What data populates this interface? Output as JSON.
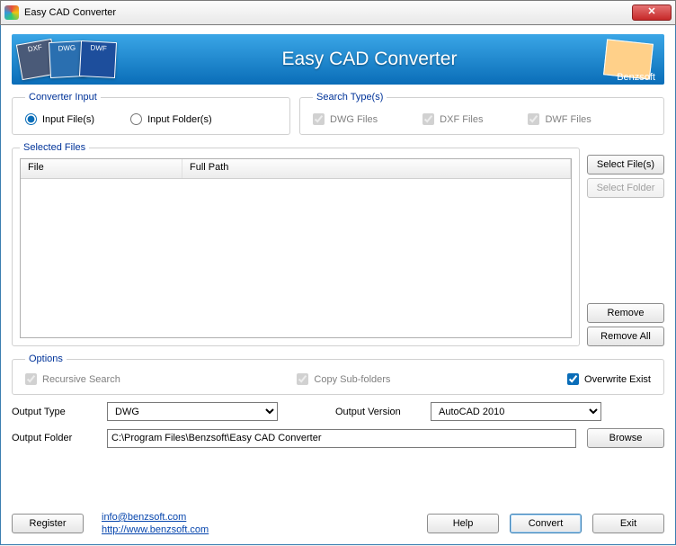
{
  "window": {
    "title": "Easy CAD Converter"
  },
  "banner": {
    "title": "Easy CAD Converter",
    "brand": "Benzsoft",
    "thumbs": [
      "DXF",
      "DWG",
      "DWF"
    ]
  },
  "converter_input": {
    "legend": "Converter Input",
    "input_files": "Input File(s)",
    "input_folders": "Input Folder(s)"
  },
  "search_types": {
    "legend": "Search Type(s)",
    "dwg": "DWG Files",
    "dxf": "DXF Files",
    "dwf": "DWF Files"
  },
  "selected_files": {
    "legend": "Selected Files",
    "col_file": "File",
    "col_path": "Full Path"
  },
  "side": {
    "select_files": "Select File(s)",
    "select_folder": "Select Folder",
    "remove": "Remove",
    "remove_all": "Remove All"
  },
  "options": {
    "legend": "Options",
    "recursive": "Recursive Search",
    "copy_sub": "Copy Sub-folders",
    "overwrite": "Overwrite Exist"
  },
  "output_type": {
    "label": "Output Type",
    "value": "DWG"
  },
  "output_version": {
    "label": "Output Version",
    "value": "AutoCAD 2010"
  },
  "output_folder": {
    "label": "Output Folder",
    "value": "C:\\Program Files\\Benzsoft\\Easy CAD Converter",
    "browse": "Browse"
  },
  "footer": {
    "register": "Register",
    "email": "info@benzsoft.com",
    "url": "http://www.benzsoft.com",
    "help": "Help",
    "convert": "Convert",
    "exit": "Exit"
  }
}
